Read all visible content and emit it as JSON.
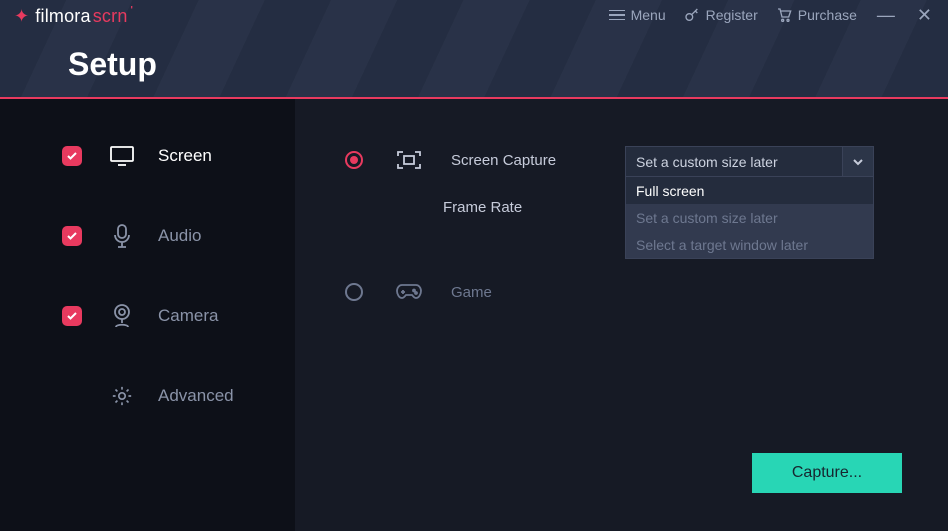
{
  "colors": {
    "accent_pink": "#e83a5f",
    "accent_teal": "#28d6b5"
  },
  "logo": {
    "word1": "filmora",
    "word2": "scrn",
    "mark": "'"
  },
  "header": {
    "title": "Setup",
    "menu": "Menu",
    "register": "Register",
    "purchase": "Purchase"
  },
  "sidebar": {
    "items": [
      {
        "label": "Screen",
        "checked": true,
        "icon": "monitor-icon",
        "active": true
      },
      {
        "label": "Audio",
        "checked": true,
        "icon": "mic-icon",
        "active": false
      },
      {
        "label": "Camera",
        "checked": true,
        "icon": "camera-icon",
        "active": false
      },
      {
        "label": "Advanced",
        "checked": false,
        "icon": "gear-icon",
        "active": false
      }
    ]
  },
  "main": {
    "screen_capture_label": "Screen Capture",
    "frame_rate_label": "Frame Rate",
    "game_label": "Game",
    "capture_button": "Capture...",
    "dropdown": {
      "selected": "Set a custom size later",
      "options": [
        "Full screen",
        "Set a custom size later",
        "Select a target window later"
      ],
      "highlighted_index": 0
    },
    "radio_selected": "screen_capture"
  }
}
